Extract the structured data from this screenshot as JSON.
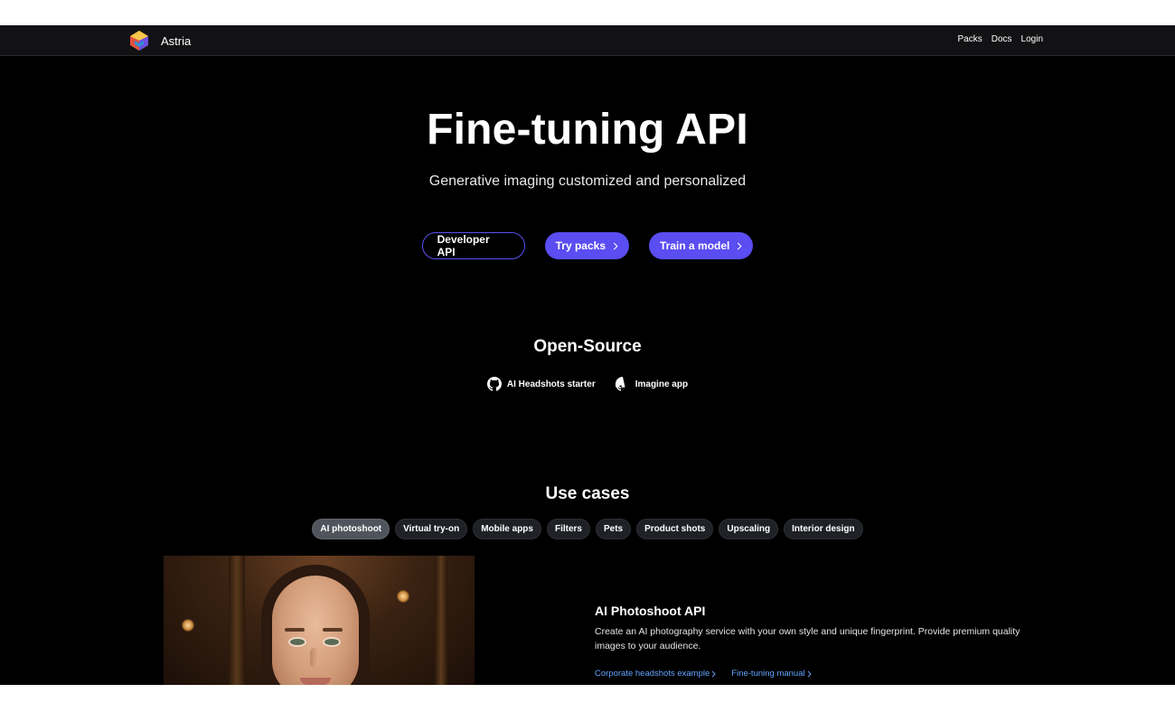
{
  "navbar": {
    "brand": "Astria",
    "links": [
      "Packs",
      "Docs",
      "Login"
    ]
  },
  "hero": {
    "title": "Fine-tuning API",
    "subtitle": "Generative imaging customized and personalized",
    "buttons": {
      "developer_api": "Developer API",
      "try_packs": "Try packs",
      "train_model": "Train a model"
    }
  },
  "open_source": {
    "title": "Open-Source",
    "links": [
      "AI Headshots starter",
      "Imagine app"
    ]
  },
  "use_cases": {
    "title": "Use cases",
    "tabs": [
      "AI photoshoot",
      "Virtual try-on",
      "Mobile apps",
      "Filters",
      "Pets",
      "Product shots",
      "Upscaling",
      "Interior design"
    ],
    "active_tab": "AI photoshoot",
    "detail": {
      "heading": "AI Photoshoot API",
      "description": "Create an AI photography service with your own style and unique fingerprint. Provide premium quality images to your audience.",
      "links": [
        "Corporate headshots example",
        "Fine-tuning manual"
      ]
    }
  },
  "colors": {
    "background": "#000000",
    "navbar": "#121214",
    "accent": "#5a4df2",
    "link": "#63a4ff"
  },
  "icons": {
    "logo": "astria-logo",
    "github": "github-icon",
    "chevron": "chevron-right-icon"
  }
}
